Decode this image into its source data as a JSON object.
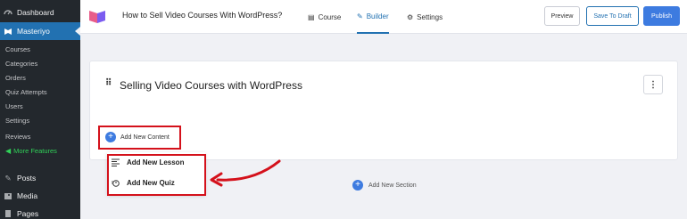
{
  "sidebar": {
    "items": [
      {
        "label": "Dashboard",
        "icon": "dashboard-icon"
      },
      {
        "label": "Masteriyo",
        "icon": "masteriyo-icon",
        "active": true
      }
    ],
    "submenu": [
      "Courses",
      "Categories",
      "Orders",
      "Quiz Attempts",
      "Users",
      "Settings",
      "Reviews"
    ],
    "more_features": "More Features",
    "bottom_items": [
      {
        "label": "Posts",
        "icon": "pin-icon"
      },
      {
        "label": "Media",
        "icon": "media-icon"
      },
      {
        "label": "Pages",
        "icon": "pages-icon"
      }
    ]
  },
  "header": {
    "title": "How to Sell Video Courses With WordPress?",
    "tabs": [
      {
        "label": "Course",
        "icon": "document-icon"
      },
      {
        "label": "Builder",
        "icon": "edit-icon",
        "active": true
      },
      {
        "label": "Settings",
        "icon": "gear-icon"
      }
    ],
    "preview_label": "Preview",
    "save_draft_label": "Save To Draft",
    "publish_label": "Publish"
  },
  "builder": {
    "section_title": "Selling Video Courses with WordPress",
    "add_content_label": "Add New Content",
    "menu": {
      "lesson_label": "Add New Lesson",
      "quiz_label": "Add New Quiz"
    },
    "add_section_label": "Add New Section"
  },
  "colors": {
    "accent": "#2271b1",
    "primary_button": "#3d7be0",
    "highlight": "#d4111b",
    "sidebar_bg": "#23282d"
  }
}
